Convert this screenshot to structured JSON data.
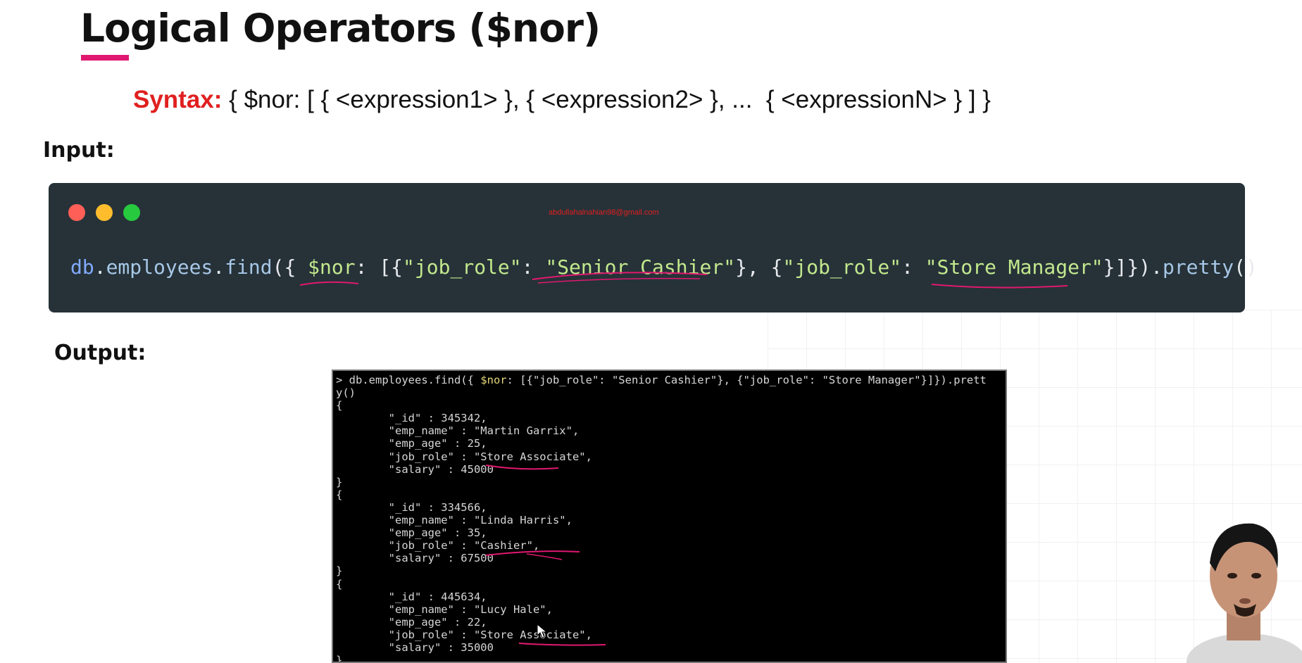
{
  "slide": {
    "title": "Logical Operators ($nor)",
    "syntax_label": "Syntax:",
    "syntax_text": " { $nor: [ { <expression1> }, { <expression2> }, ...  { <expressionN> } ] }",
    "input_label": "Input:",
    "output_label": "Output:"
  },
  "code_card": {
    "watermark": "abdullahalnahian98@gmail.com",
    "parts": {
      "db": "db",
      "dot1": ".",
      "collection": "employees",
      "dot2": ".",
      "find": "find",
      "open": "({ ",
      "op": "$nor",
      "colon": ": [{",
      "key1": "\"job_role\"",
      "colon2": ": ",
      "val1": "\"Senior Cashier\"",
      "mid": "}, {",
      "key2": "\"job_role\"",
      "colon3": ": ",
      "val2": "\"Store Manager\"",
      "close": "}]}).",
      "pretty": "pretty",
      "end": "()"
    }
  },
  "terminal": {
    "lines": [
      "> db.employees.find({ ",
      "y()",
      "{",
      "        \"_id\" : 345342,",
      "        \"emp_name\" : \"Martin Garrix\",",
      "        \"emp_age\" : 25,",
      "        \"job_role\" : \"Store Associate\",",
      "        \"salary\" : 45000",
      "}",
      "{",
      "        \"_id\" : 334566,",
      "        \"emp_name\" : \"Linda Harris\",",
      "        \"emp_age\" : 35,",
      "        \"job_role\" : \"Cashier\",",
      "        \"salary\" : 67500",
      "}",
      "{",
      "        \"_id\" : 445634,",
      "        \"emp_name\" : \"Lucy Hale\",",
      "        \"emp_age\" : 22,",
      "        \"job_role\" : \"Store Associate\",",
      "        \"salary\" : 35000",
      "}"
    ],
    "first_line_op": "$nor",
    "first_line_rest": ": [{\"job_role\": \"Senior Cashier\"}, {\"job_role\": \"Store Manager\"}]}).prett"
  },
  "colors": {
    "accent": "#e0186f",
    "syntax_label": "#e02020",
    "code_bg": "#263238",
    "terminal_bg": "#000000"
  }
}
